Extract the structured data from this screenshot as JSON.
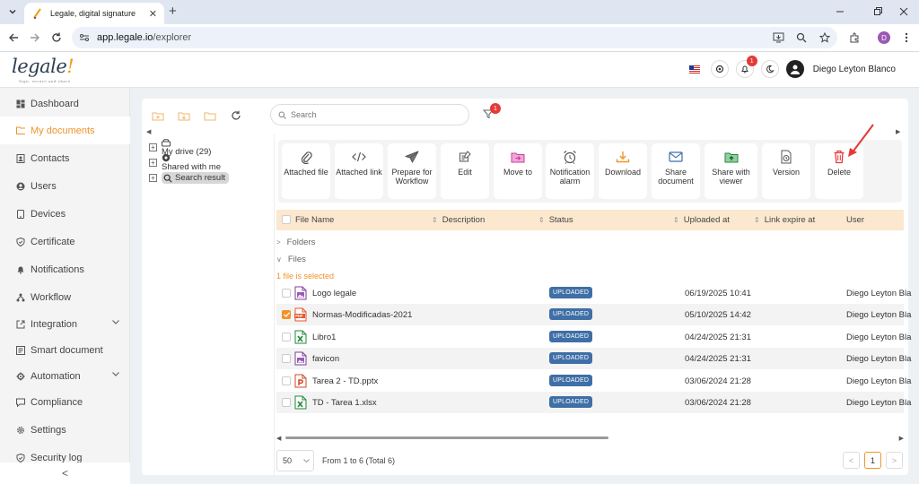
{
  "browser": {
    "tab_title": "Legale, digital signature",
    "url_host": "app.legale.io",
    "url_path": "/explorer",
    "profile_initial": "D"
  },
  "header": {
    "logo_text": "legale",
    "logo_tagline": "Sign. secure and share",
    "notification_count": "1",
    "user_name": "Diego Leyton Blanco"
  },
  "sidebar": {
    "items": [
      {
        "label": "Dashboard",
        "icon": "dashboard-icon"
      },
      {
        "label": "My documents",
        "icon": "folder-icon",
        "active": true
      },
      {
        "label": "Contacts",
        "icon": "contacts-icon"
      },
      {
        "label": "Users",
        "icon": "user-icon"
      },
      {
        "label": "Devices",
        "icon": "device-icon"
      },
      {
        "label": "Certificate",
        "icon": "certificate-icon"
      },
      {
        "label": "Notifications",
        "icon": "notification-icon"
      },
      {
        "label": "Workflow",
        "icon": "workflow-icon"
      },
      {
        "label": "Integration",
        "icon": "integration-icon",
        "expandable": true
      },
      {
        "label": "Smart document",
        "icon": "smart-document-icon"
      },
      {
        "label": "Automation",
        "icon": "automation-icon",
        "expandable": true
      },
      {
        "label": "Compliance",
        "icon": "compliance-icon"
      },
      {
        "label": "Settings",
        "icon": "settings-icon"
      },
      {
        "label": "Security log",
        "icon": "security-log-icon"
      }
    ],
    "collapse_label": "<"
  },
  "explorer": {
    "search_placeholder": "Search",
    "filter_count": "1",
    "tree": [
      {
        "label": "My drive (29)",
        "icon": "drive-icon"
      },
      {
        "label": "Shared with me",
        "icon": "shared-icon"
      },
      {
        "label": "Search result",
        "icon": "search-icon",
        "selected": true
      }
    ]
  },
  "actions": [
    {
      "label": "Attached file",
      "icon": "paperclip-icon"
    },
    {
      "label": "Attached link",
      "icon": "code-link-icon"
    },
    {
      "label": "Prepare for Workflow",
      "icon": "send-icon"
    },
    {
      "label": "Edit",
      "icon": "edit-icon"
    },
    {
      "label": "Move to",
      "icon": "move-folder-icon"
    },
    {
      "label": "Notification alarm",
      "icon": "alarm-icon"
    },
    {
      "label": "Download",
      "icon": "download-icon"
    },
    {
      "label": "Share document",
      "icon": "mail-icon"
    },
    {
      "label": "Share with viewer",
      "icon": "share-folder-icon"
    },
    {
      "label": "Version",
      "icon": "version-icon"
    },
    {
      "label": "Delete",
      "icon": "trash-icon"
    }
  ],
  "table": {
    "columns": {
      "file_name": "File Name",
      "description": "Description",
      "status": "Status",
      "uploaded_at": "Uploaded at",
      "link_expire_at": "Link expire at",
      "user": "User"
    },
    "group_folders": "Folders",
    "group_files": "Files",
    "selection_info": "1 file is selected",
    "rows": [
      {
        "name": "Logo legale",
        "type": "image",
        "status": "UPLOADED",
        "uploaded": "06/19/2025 10:41",
        "user": "Diego Leyton Bla",
        "checked": false
      },
      {
        "name": "Normas-Modificadas-2021",
        "type": "pdf",
        "status": "UPLOADED",
        "uploaded": "05/10/2025 14:42",
        "user": "Diego Leyton Bla",
        "checked": true
      },
      {
        "name": "Libro1",
        "type": "excel",
        "status": "UPLOADED",
        "uploaded": "04/24/2025 21:31",
        "user": "Diego Leyton Bla",
        "checked": false
      },
      {
        "name": "favicon",
        "type": "image",
        "status": "UPLOADED",
        "uploaded": "04/24/2025 21:31",
        "user": "Diego Leyton Bla",
        "checked": false
      },
      {
        "name": "Tarea 2 - TD.pptx",
        "type": "ppt",
        "status": "UPLOADED",
        "uploaded": "03/06/2024 21:28",
        "user": "Diego Leyton Bla",
        "checked": false
      },
      {
        "name": "TD - Tarea 1.xlsx",
        "type": "excel",
        "status": "UPLOADED",
        "uploaded": "03/06/2024 21:28",
        "user": "Diego Leyton Bla",
        "checked": false
      }
    ]
  },
  "pagination": {
    "page_size": "50",
    "info": "From 1 to 6 (Total 6)",
    "current_page": "1",
    "prev": "<",
    "next": ">"
  },
  "colors": {
    "accent": "#f0932b",
    "status_badge": "#3f6fa6",
    "header_row": "#fbe8cf",
    "badge_red": "#e53935"
  }
}
